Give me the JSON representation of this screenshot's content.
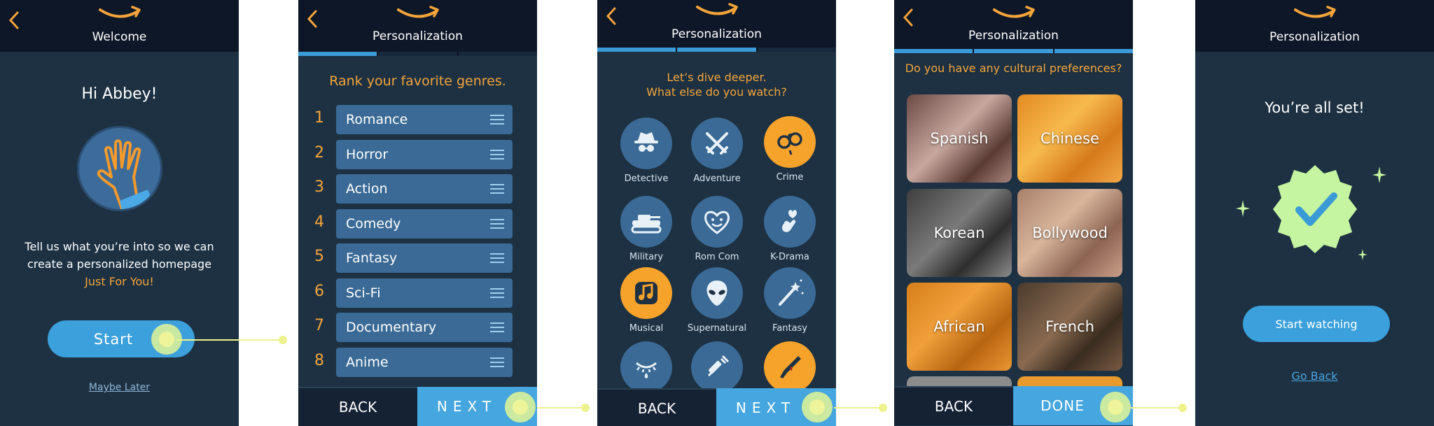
{
  "screen1": {
    "title": "Welcome",
    "greeting": "Hi Abbey!",
    "intro_line1": "Tell us what you’re into so we can",
    "intro_line2": "create a personalized homepage",
    "intro_accent": "Just For You!",
    "start_label": "Start",
    "maybe_later": "Maybe Later"
  },
  "screen2": {
    "title": "Personalization",
    "heading": "Rank your favorite genres.",
    "ranks": [
      {
        "num": "1",
        "label": "Romance"
      },
      {
        "num": "2",
        "label": "Horror"
      },
      {
        "num": "3",
        "label": "Action"
      },
      {
        "num": "4",
        "label": "Comedy"
      },
      {
        "num": "5",
        "label": "Fantasy"
      },
      {
        "num": "6",
        "label": "Sci-Fi"
      },
      {
        "num": "7",
        "label": "Documentary"
      },
      {
        "num": "8",
        "label": "Anime"
      }
    ],
    "back_label": "BACK",
    "next_label": "NEXT"
  },
  "screen3": {
    "title": "Personalization",
    "heading_line1": "Let’s dive deeper.",
    "heading_line2": "What else do you watch?",
    "categories": [
      {
        "label": "Detective",
        "icon": "detective-icon",
        "selected": false
      },
      {
        "label": "Adventure",
        "icon": "crossed-swords-icon",
        "selected": false
      },
      {
        "label": "Crime",
        "icon": "handcuffs-icon",
        "selected": true
      },
      {
        "label": "Military",
        "icon": "tank-icon",
        "selected": false
      },
      {
        "label": "Rom Com",
        "icon": "smiling-heart-icon",
        "selected": false
      },
      {
        "label": "K-Drama",
        "icon": "finger-heart-icon",
        "selected": false
      },
      {
        "label": "Musical",
        "icon": "music-note-icon",
        "selected": true
      },
      {
        "label": "Supernatural",
        "icon": "alien-icon",
        "selected": false
      },
      {
        "label": "Fantasy",
        "icon": "magic-wand-icon",
        "selected": false
      },
      {
        "icon": "crying-eye-icon",
        "selected": false
      },
      {
        "icon": "syringe-icon",
        "selected": false
      },
      {
        "icon": "bloody-knife-icon",
        "selected": true
      }
    ],
    "back_label": "BACK",
    "next_label": "NEXT"
  },
  "screen4": {
    "title": "Personalization",
    "question": "Do you have any cultural preferences?",
    "tiles": [
      "Spanish",
      "Chinese",
      "Korean",
      "Bollywood",
      "African",
      "French"
    ],
    "back_label": "BACK",
    "done_label": "DONE"
  },
  "screen5": {
    "title": "Personalization",
    "heading": "You’re all set!",
    "watch_label": "Start watching",
    "go_back": "Go Back"
  },
  "colors": {
    "background": "#1d3142",
    "header": "#0e1727",
    "accent_orange": "#f4a43a",
    "accent_blue": "#3ba0dc",
    "item_blue": "#3a6a95",
    "tap_highlight": "#eef28c",
    "badge_green": "#c5f5a0"
  }
}
